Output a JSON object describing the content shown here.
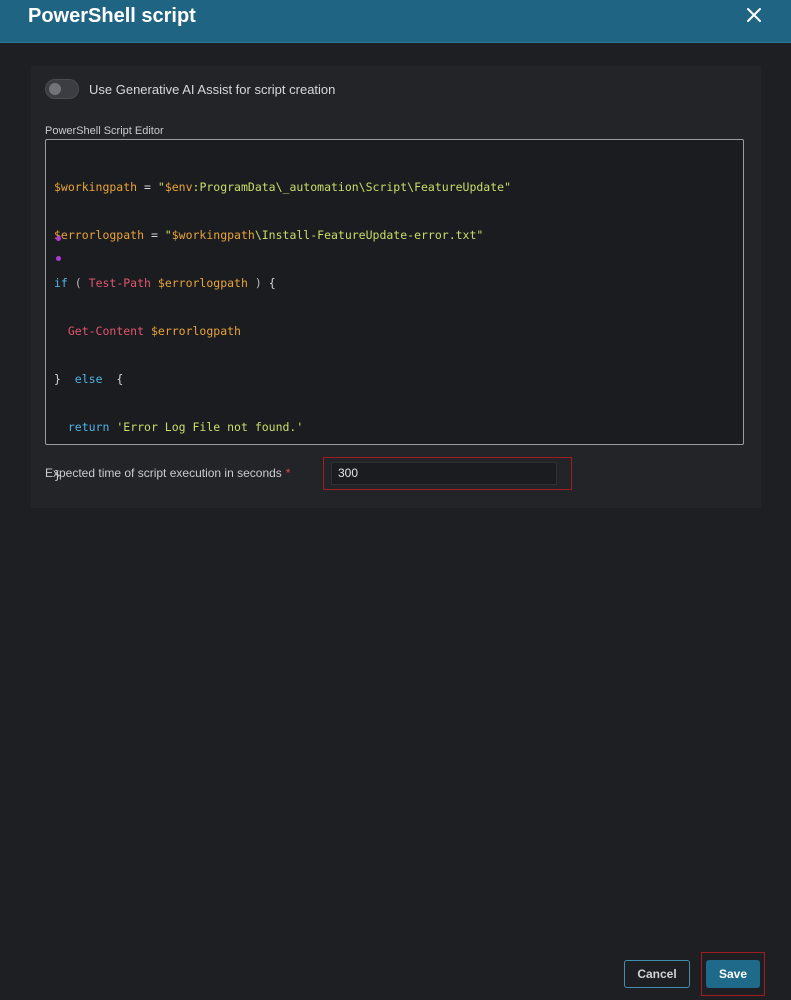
{
  "dialog": {
    "title": "PowerShell script",
    "close_icon": "close-icon"
  },
  "ai_assist": {
    "label": "Use Generative AI Assist for script creation",
    "enabled": false
  },
  "editor": {
    "label": "PowerShell Script Editor",
    "code_lines": [
      "$workingpath = \"$env:ProgramData\\_automation\\Script\\FeatureUpdate\"",
      "$errorlogpath = \"$workingpath\\Install-FeatureUpdate-error.txt\"",
      "if ( Test-Path $errorlogpath ) {",
      "  Get-Content $errorlogpath",
      "}  else  {",
      "  return 'Error Log File not found.'",
      "}"
    ]
  },
  "execution_time": {
    "label": "Expected time of script execution in seconds",
    "required_mark": "*",
    "value": "300"
  },
  "footer": {
    "cancel_label": "Cancel",
    "save_label": "Save"
  },
  "colors": {
    "header": "#1f6482",
    "background": "#1e1f22",
    "highlight_border": "#a11d24",
    "save_button": "#1f6a8a",
    "syntax_variable": "#e8a33a",
    "syntax_string": "#c6df6a",
    "syntax_keyword": "#4fb3e8",
    "syntax_command": "#e0566e"
  }
}
